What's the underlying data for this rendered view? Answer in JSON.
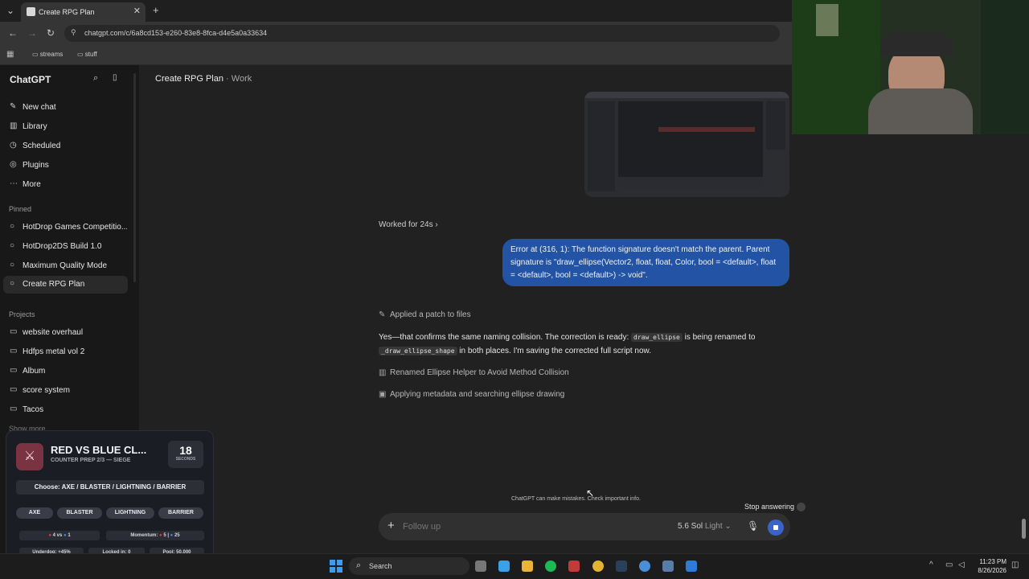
{
  "browser": {
    "tab_title": "Create RPG Plan",
    "url": "chatgpt.com/c/6a8cd153-e260-83e8-8fca-d4e5a0a33634",
    "bookmarks": [
      "streams",
      "stuff"
    ]
  },
  "sidebar": {
    "brand": "ChatGPT",
    "nav": [
      {
        "label": "New chat",
        "icon": "edit-icon"
      },
      {
        "label": "Library",
        "icon": "library-icon"
      },
      {
        "label": "Scheduled",
        "icon": "clock-icon"
      },
      {
        "label": "Plugins",
        "icon": "plugin-icon"
      },
      {
        "label": "More",
        "icon": "more-icon"
      }
    ],
    "pinned_heading": "Pinned",
    "pinned": [
      "HotDrop Games Competitio...",
      "HotDrop2DS Build 1.0",
      "Maximum Quality Mode",
      "Create RPG Plan"
    ],
    "projects_heading": "Projects",
    "projects": [
      "website overhaul",
      "Hdfps metal vol 2",
      "Album",
      "score system",
      "Tacos"
    ],
    "show_more": "Show more"
  },
  "header": {
    "title": "Create RPG Plan",
    "project": "Work"
  },
  "conversation": {
    "worked_for": "Worked for 24s",
    "user_message": "Error at (316, 1): The function signature doesn't match the parent. Parent signature is \"draw_ellipse(Vector2, float, float, Color, bool = <default>, float = <default>, bool = <default>) -> void\".",
    "step_patch": "Applied a patch to files",
    "reply_part1": "Yes—that confirms the same naming collision. The correction is ready:",
    "reply_code1": "draw_ellipse",
    "reply_part2": "is being renamed to",
    "reply_code2": "_draw_ellipse_shape",
    "reply_part3": "in both places. I'm saving the corrected full script now.",
    "step_renamed": "Renamed Ellipse Helper to Avoid Method Collision",
    "step_applying": "Applying metadata and searching ellipse drawing"
  },
  "composer": {
    "placeholder": "Follow up",
    "model": "5.6 Sol",
    "mode": "Light",
    "disclaimer": "ChatGPT can make mistakes. Check important info.",
    "stop_label": "Stop answering"
  },
  "widget": {
    "title": "RED VS BLUE CL...",
    "subtitle": "COUNTER PREP 2/3 — SIEGE",
    "timer": "18",
    "timer_unit": "SECONDS",
    "choose": "Choose: AXE / BLASTER / LIGHTNING / BARRIER",
    "options": [
      "AXE",
      "BLASTER",
      "LIGHTNING",
      "BARRIER"
    ],
    "score_red": "4",
    "score_vs": "vs",
    "score_blue": "1",
    "momentum_label": "Momentum:",
    "momentum_red": "5",
    "momentum_blue": "25",
    "underdog_label": "Underdog:",
    "underdog_value": "+45%",
    "locked_label": "Locked in:",
    "locked_value": "0",
    "pool_label": "Pool:",
    "pool_value": "50,000",
    "progress_fraction": 0.55,
    "colors": {
      "red": "#e04343",
      "blue": "#3f8fe8"
    }
  },
  "taskbar": {
    "search": "Search",
    "time": "11:23 PM",
    "date": "8/26/2026"
  }
}
